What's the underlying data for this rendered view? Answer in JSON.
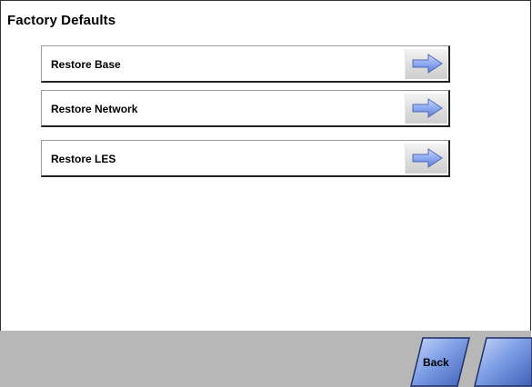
{
  "header": {
    "title": "Factory Defaults"
  },
  "options": [
    {
      "label": "Restore Base",
      "icon": "arrow-right-icon"
    },
    {
      "label": "Restore Network",
      "icon": "arrow-right-icon"
    },
    {
      "label": "Restore LES",
      "icon": "arrow-right-icon"
    }
  ],
  "footer": {
    "back_label": "Back",
    "next_label": ""
  },
  "colors": {
    "footer_bar": "#b7b7b7",
    "button_blue": "#5f84d6",
    "arrow_blue": "#7d9de6"
  }
}
